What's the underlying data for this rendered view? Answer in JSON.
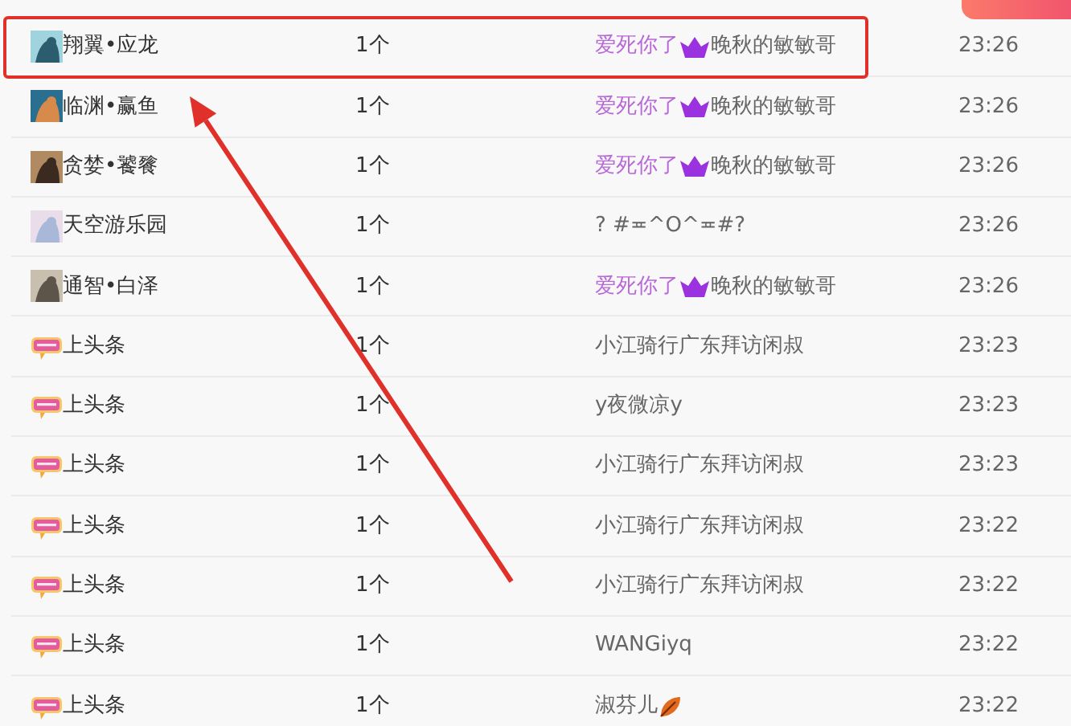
{
  "top_button": {
    "shown": true
  },
  "rows": [
    {
      "kind": "avatar",
      "name": "翔翼•应龙",
      "count": "1个",
      "sender": {
        "kind": "vip",
        "prefix": "爱死你了",
        "name": "晚秋的敏敏哥"
      },
      "time": "23:26",
      "highlighted": true
    },
    {
      "kind": "avatar",
      "name": "临渊•赢鱼",
      "count": "1个",
      "sender": {
        "kind": "vip",
        "prefix": "爱死你了",
        "name": "晚秋的敏敏哥"
      },
      "time": "23:26",
      "highlighted": false
    },
    {
      "kind": "avatar",
      "name": "贪婪•饕餮",
      "count": "1个",
      "sender": {
        "kind": "vip",
        "prefix": "爱死你了",
        "name": "晚秋的敏敏哥"
      },
      "time": "23:26",
      "highlighted": false
    },
    {
      "kind": "avatar",
      "name": "天空游乐园",
      "count": "1个",
      "sender": {
        "kind": "plain",
        "name": "? #≖^O^≖#?"
      },
      "time": "23:26",
      "highlighted": false
    },
    {
      "kind": "avatar",
      "name": "通智•白泽",
      "count": "1个",
      "sender": {
        "kind": "vip",
        "prefix": "爱死你了",
        "name": "晚秋的敏敏哥"
      },
      "time": "23:26",
      "highlighted": false
    },
    {
      "kind": "badge",
      "name": "上头条",
      "count": "1个",
      "sender": {
        "kind": "plain",
        "name": "小江骑行广东拜访闲叔"
      },
      "time": "23:23",
      "highlighted": false
    },
    {
      "kind": "badge",
      "name": "上头条",
      "count": "1个",
      "sender": {
        "kind": "plain",
        "name": "y夜微凉y"
      },
      "time": "23:23",
      "highlighted": false
    },
    {
      "kind": "badge",
      "name": "上头条",
      "count": "1个",
      "sender": {
        "kind": "plain",
        "name": "小江骑行广东拜访闲叔"
      },
      "time": "23:23",
      "highlighted": false
    },
    {
      "kind": "badge",
      "name": "上头条",
      "count": "1个",
      "sender": {
        "kind": "plain",
        "name": "小江骑行广东拜访闲叔"
      },
      "time": "23:22",
      "highlighted": false
    },
    {
      "kind": "badge",
      "name": "上头条",
      "count": "1个",
      "sender": {
        "kind": "plain",
        "name": "小江骑行广东拜访闲叔"
      },
      "time": "23:22",
      "highlighted": false
    },
    {
      "kind": "badge",
      "name": "上头条",
      "count": "1个",
      "sender": {
        "kind": "plain",
        "name": "WANGiyq"
      },
      "time": "23:22",
      "highlighted": false
    },
    {
      "kind": "badge",
      "name": "上头条",
      "count": "1个",
      "sender": {
        "kind": "leaf",
        "name": "淑芬儿"
      },
      "time": "23:22",
      "highlighted": false
    }
  ]
}
